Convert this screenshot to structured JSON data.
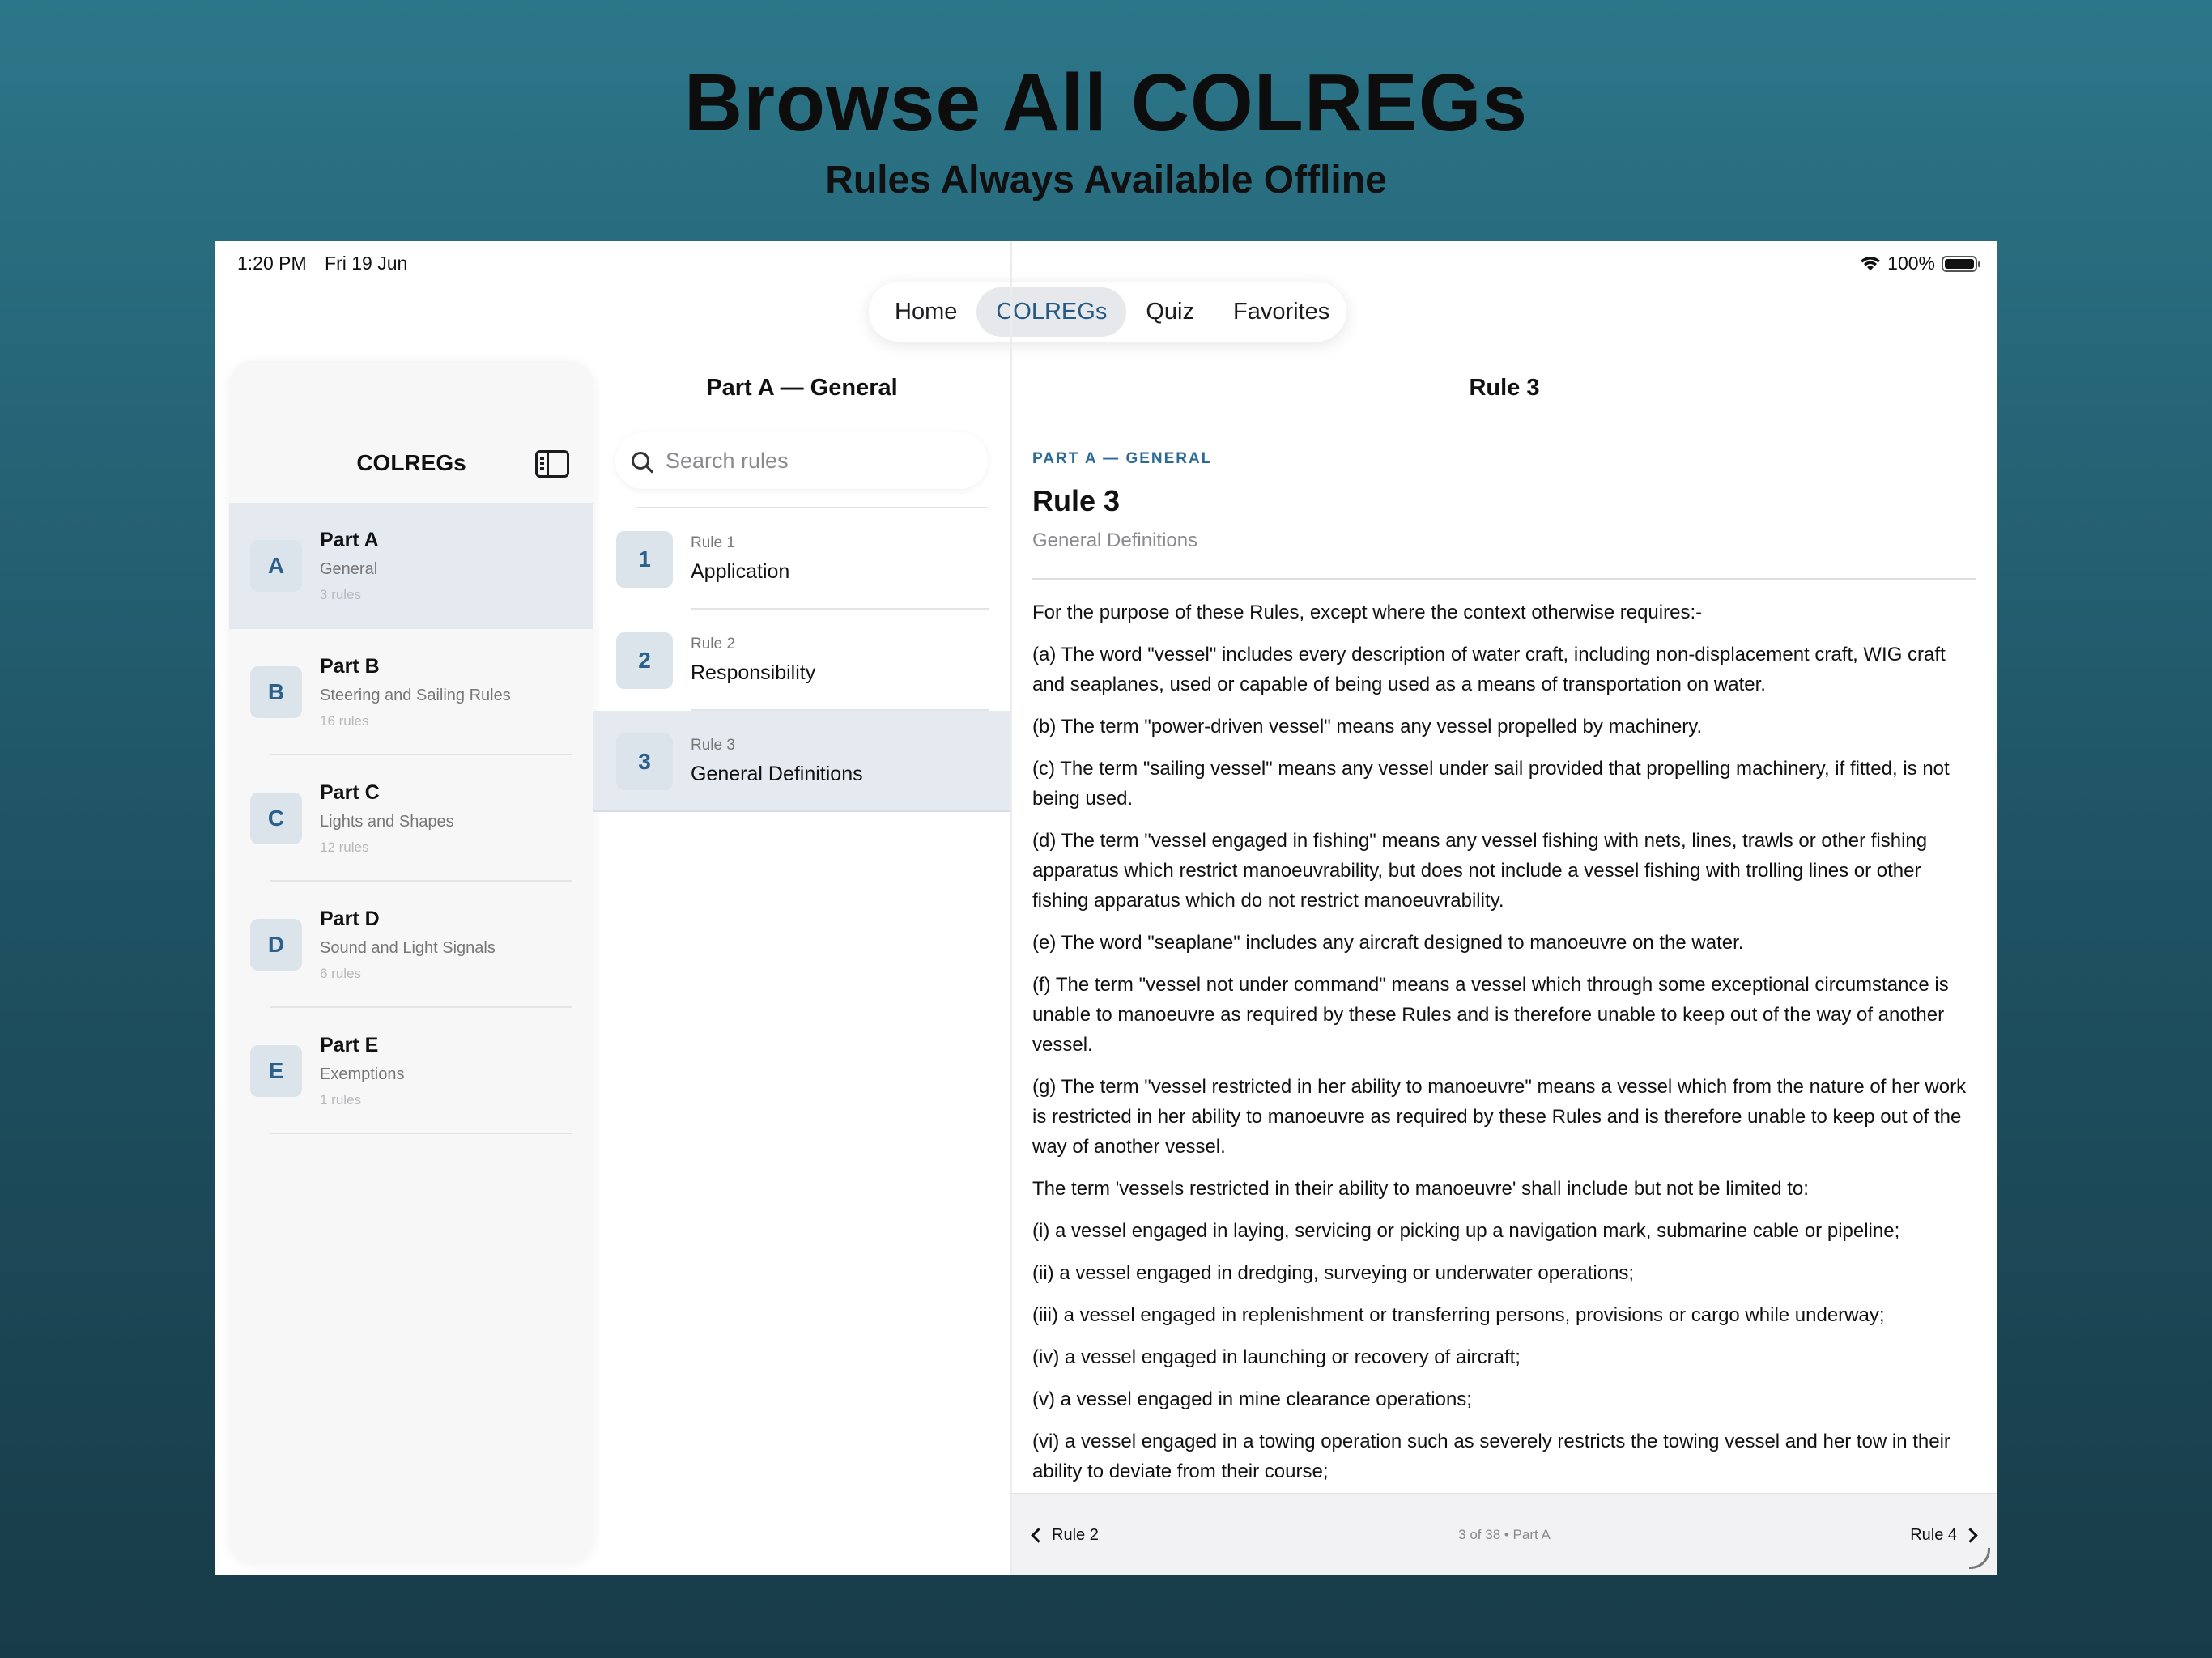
{
  "hero": {
    "title": "Browse All COLREGs",
    "subtitle": "Rules Always Available Offline"
  },
  "status": {
    "time": "1:20 PM",
    "date": "Fri 19 Jun",
    "battery": "100%",
    "icons": [
      "wifi-icon",
      "battery-icon"
    ]
  },
  "tabs": [
    {
      "label": "Home",
      "active": false
    },
    {
      "label": "COLREGs",
      "active": true
    },
    {
      "label": "Quiz",
      "active": false
    },
    {
      "label": "Favorites",
      "active": false
    }
  ],
  "sidebar": {
    "title": "COLREGs",
    "toggle_icon": "sidebar-toggle-icon",
    "parts": [
      {
        "badge": "A",
        "title": "Part A",
        "subtitle": "General",
        "count": "3 rules",
        "selected": true
      },
      {
        "badge": "B",
        "title": "Part B",
        "subtitle": "Steering and Sailing Rules",
        "count": "16 rules",
        "selected": false
      },
      {
        "badge": "C",
        "title": "Part C",
        "subtitle": "Lights and Shapes",
        "count": "12 rules",
        "selected": false
      },
      {
        "badge": "D",
        "title": "Part D",
        "subtitle": "Sound and Light Signals",
        "count": "6 rules",
        "selected": false
      },
      {
        "badge": "E",
        "title": "Part E",
        "subtitle": "Exemptions",
        "count": "1 rules",
        "selected": false
      }
    ]
  },
  "middle": {
    "title": "Part A — General",
    "search_placeholder": "Search rules",
    "rules": [
      {
        "badge": "1",
        "number": "Rule 1",
        "name": "Application",
        "selected": false
      },
      {
        "badge": "2",
        "number": "Rule 2",
        "name": "Responsibility",
        "selected": false
      },
      {
        "badge": "3",
        "number": "Rule 3",
        "name": "General Definitions",
        "selected": true
      }
    ]
  },
  "detail": {
    "nav_title": "Rule 3",
    "eyebrow": "PART A — GENERAL",
    "heading": "Rule 3",
    "subheading": "General Definitions",
    "paragraphs": [
      "For the purpose of these Rules, except where the context otherwise requires:-",
      "(a) The word \"vessel\" includes every description of water craft, including non-displacement craft, WIG craft and seaplanes, used or capable of being used as a means of transportation on water.",
      "(b) The term \"power-driven vessel\" means any vessel propelled by machinery.",
      "(c) The term \"sailing vessel\" means any vessel under sail provided that propelling machinery, if fitted, is not being used.",
      "(d) The term \"vessel engaged in fishing\" means any vessel fishing with nets, lines, trawls or other fishing apparatus which restrict manoeuvrability, but does not include a vessel fishing with trolling lines or other fishing apparatus which do not restrict manoeuvrability.",
      "(e) The word \"seaplane\" includes any aircraft designed to manoeuvre on the water.",
      "(f) The term \"vessel not under command\" means a vessel which through some exceptional circumstance is unable to manoeuvre as required by these Rules and is therefore unable to keep out of the way of another vessel.",
      "(g) The term \"vessel restricted in her ability to manoeuvre\" means a vessel which from the nature of her work is restricted in her ability to manoeuvre as required by these Rules and is therefore unable to keep out of the way of another vessel.",
      "The term 'vessels restricted in their ability to manoeuvre' shall include but not be limited to:",
      "(i) a vessel engaged in laying, servicing or picking up a navigation mark, submarine cable or pipeline;",
      "(ii) a vessel engaged in dredging, surveying or underwater operations;",
      "(iii) a vessel engaged in replenishment or transferring persons, provisions or cargo while underway;",
      "(iv) a vessel engaged in launching or recovery of aircraft;",
      "(v) a vessel engaged in mine clearance operations;",
      "(vi) a vessel engaged in a towing operation such as severely restricts the towing vessel and her tow in their ability to deviate from their course;"
    ]
  },
  "footer": {
    "prev_label": "Rule 2",
    "next_label": "Rule 4",
    "position": "3 of 38 • Part A"
  }
}
